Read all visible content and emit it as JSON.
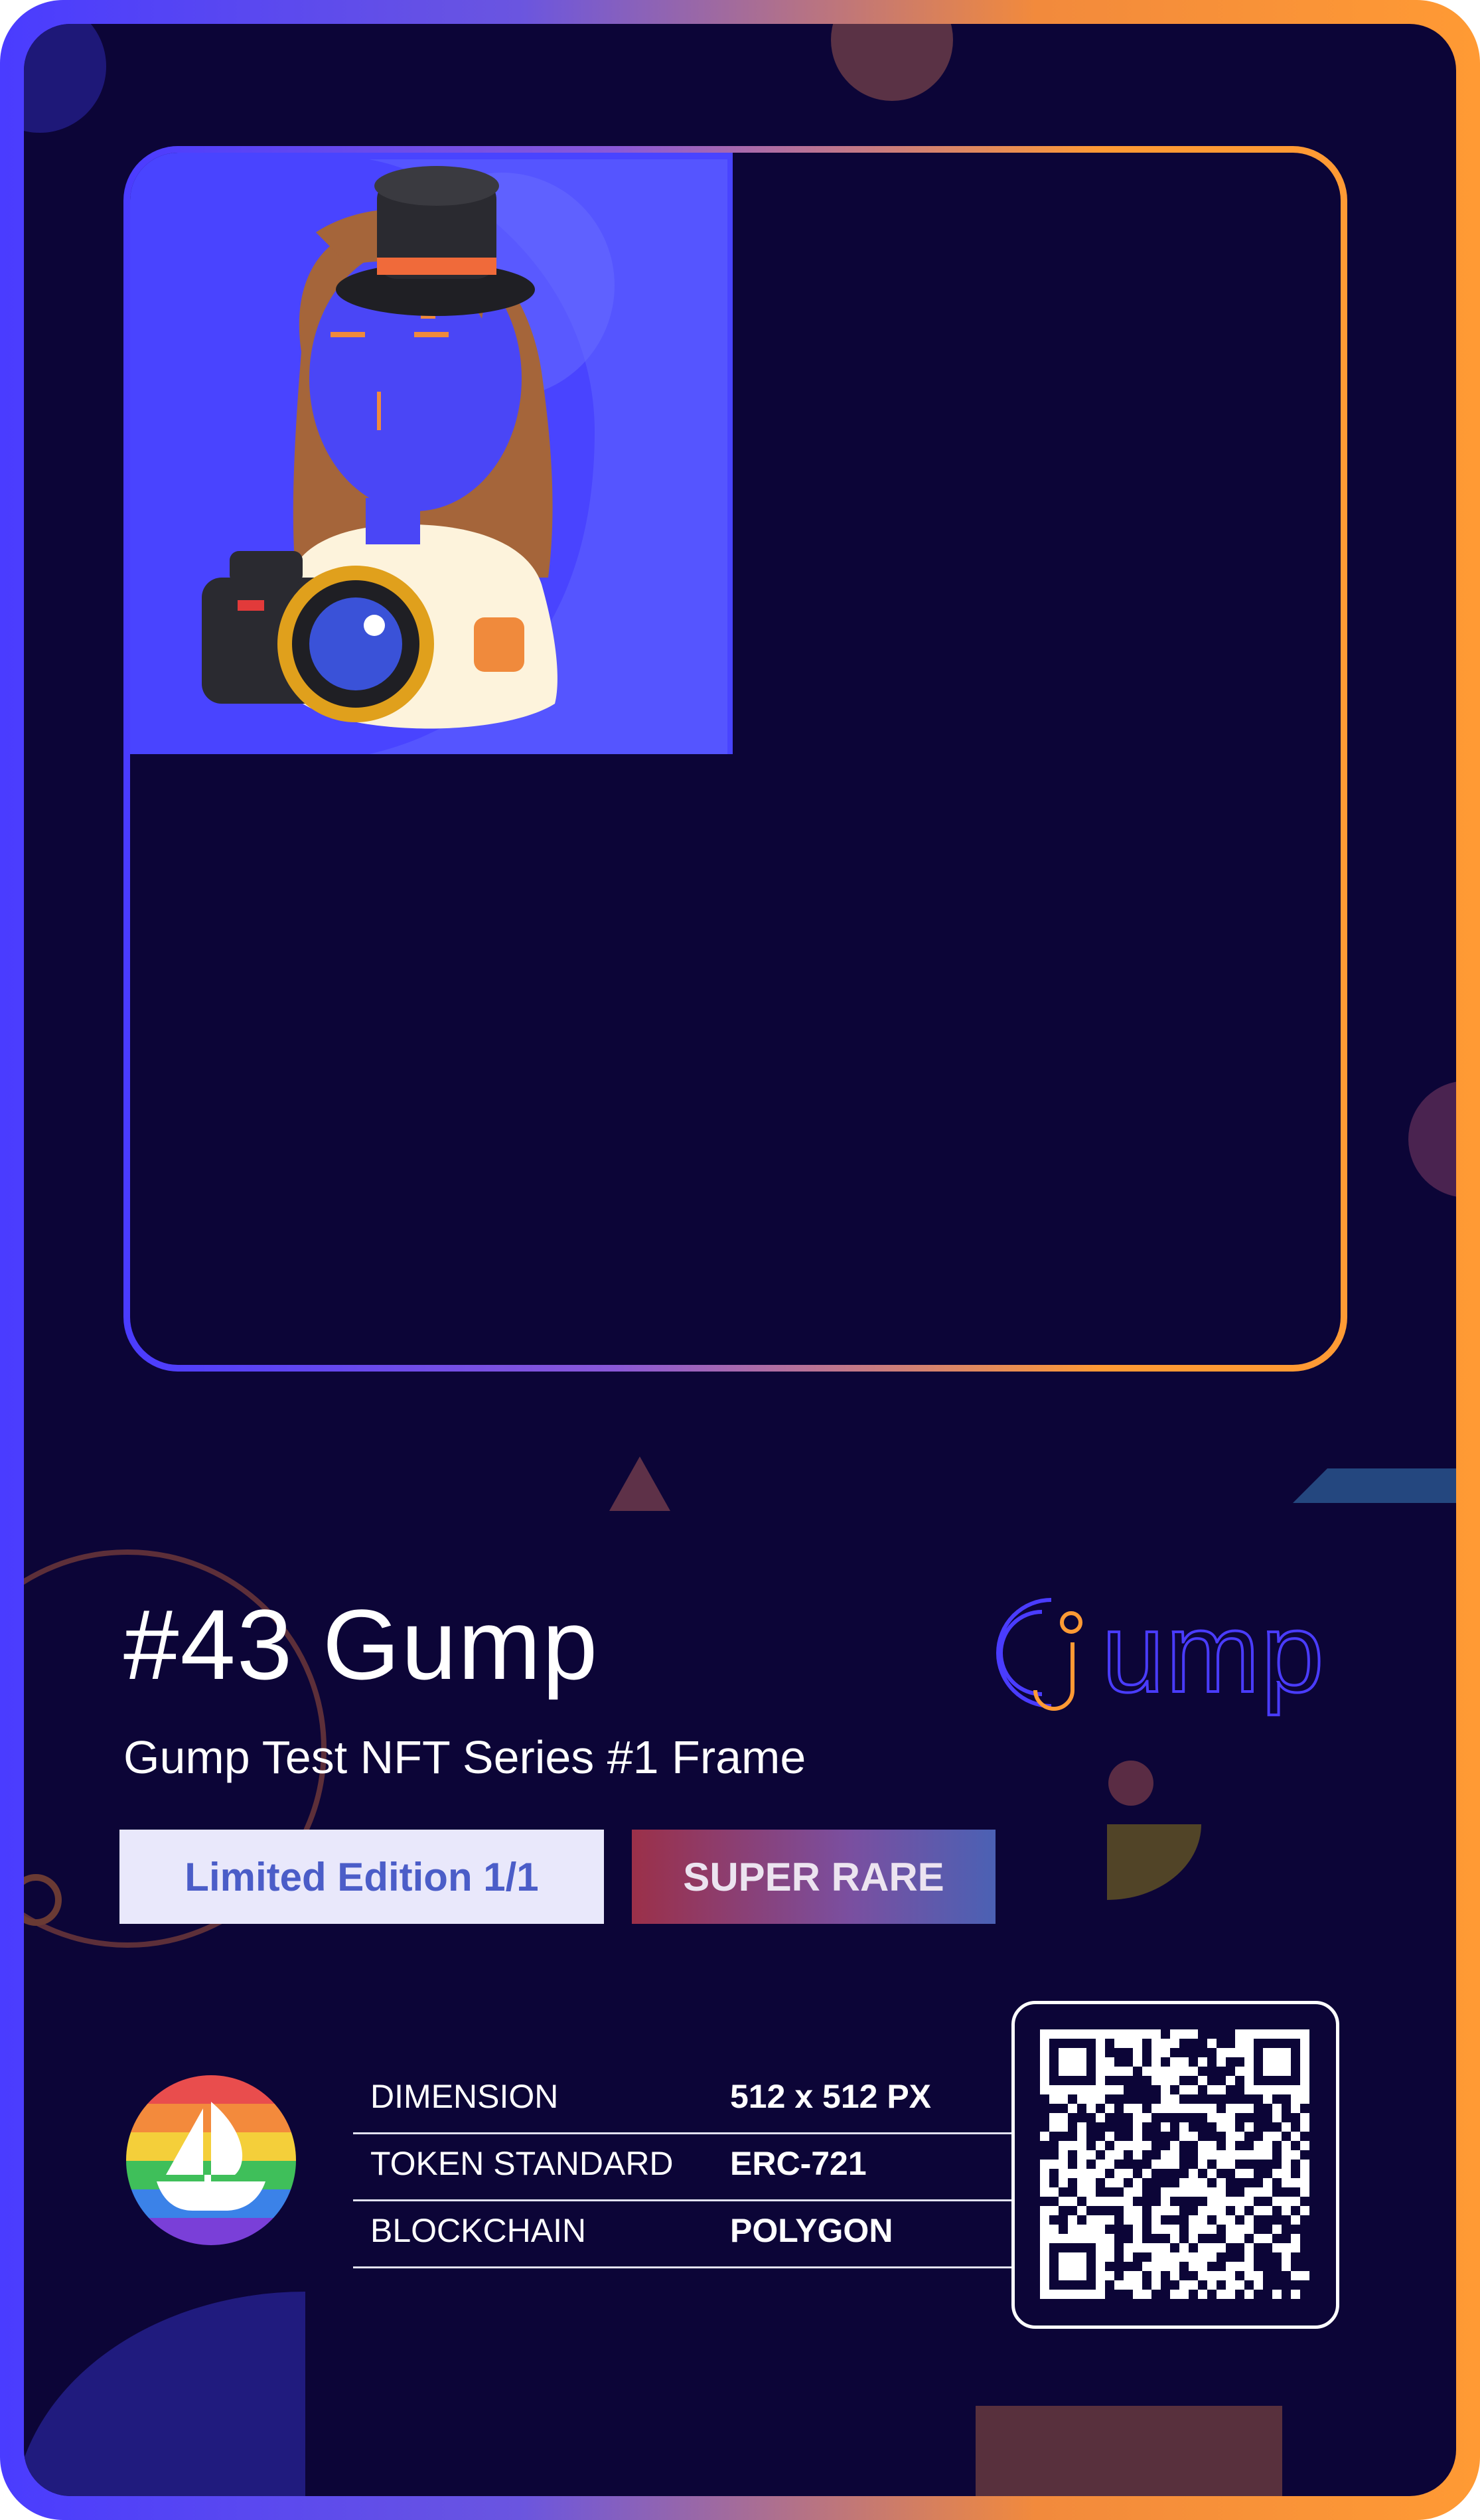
{
  "nft": {
    "title": "#43 Gump",
    "subtitle": "Gump Test NFT Series #1 Frame",
    "edition_badge": "Limited Edition 1/1",
    "rarity_badge": "SUPER RARE"
  },
  "brand": {
    "logo_text": "Gump"
  },
  "specs": [
    {
      "label": "DIMENSION",
      "value": "512 x 512 PX"
    },
    {
      "label": "TOKEN STANDARD",
      "value": "ERC-721"
    },
    {
      "label": "BLOCKCHAIN",
      "value": "POLYGON"
    }
  ],
  "icons": {
    "marketplace": "opensea-icon",
    "qr": "qr-code"
  },
  "colors": {
    "background": "#0c0537",
    "accent_blue": "#4a3cff",
    "accent_orange": "#ff9a34",
    "rarity_start": "#9b3049",
    "rarity_end": "#4b61b4",
    "edition_text": "#4b5dc8"
  }
}
